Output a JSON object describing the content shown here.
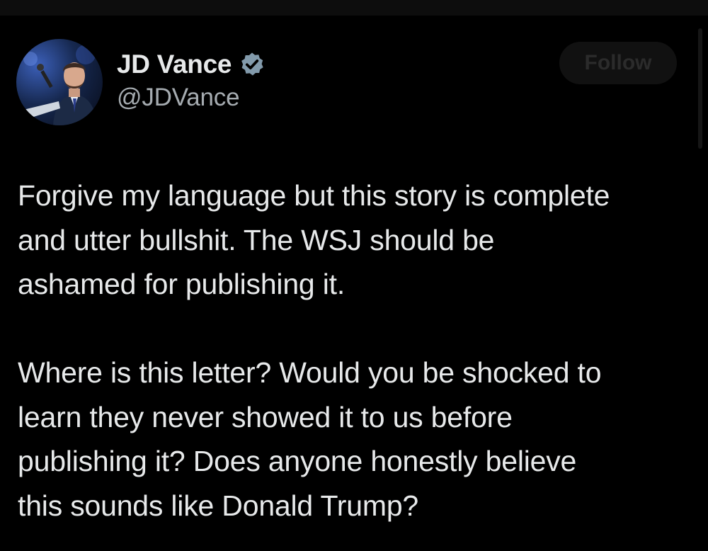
{
  "author": {
    "display_name": "JD Vance",
    "handle": "@JDVance",
    "verified": true,
    "verified_badge_color": "#829aab",
    "avatar_icon": "profile-photo"
  },
  "follow_button": {
    "label": "Follow"
  },
  "tweet": {
    "paragraphs": [
      {
        "lines": [
          "Forgive my language but this story is complete",
          "and utter bullshit. The WSJ should be",
          "ashamed for publishing it."
        ]
      },
      {
        "lines": [
          "Where is this letter? Would you be shocked to",
          "learn they never showed it to us before",
          "publishing it? Does anyone honestly believe",
          "this sounds like Donald Trump?"
        ]
      }
    ]
  },
  "colors": {
    "background": "#000000",
    "primary_text": "#e7e9ea",
    "secondary_text": "#a5abb0"
  }
}
